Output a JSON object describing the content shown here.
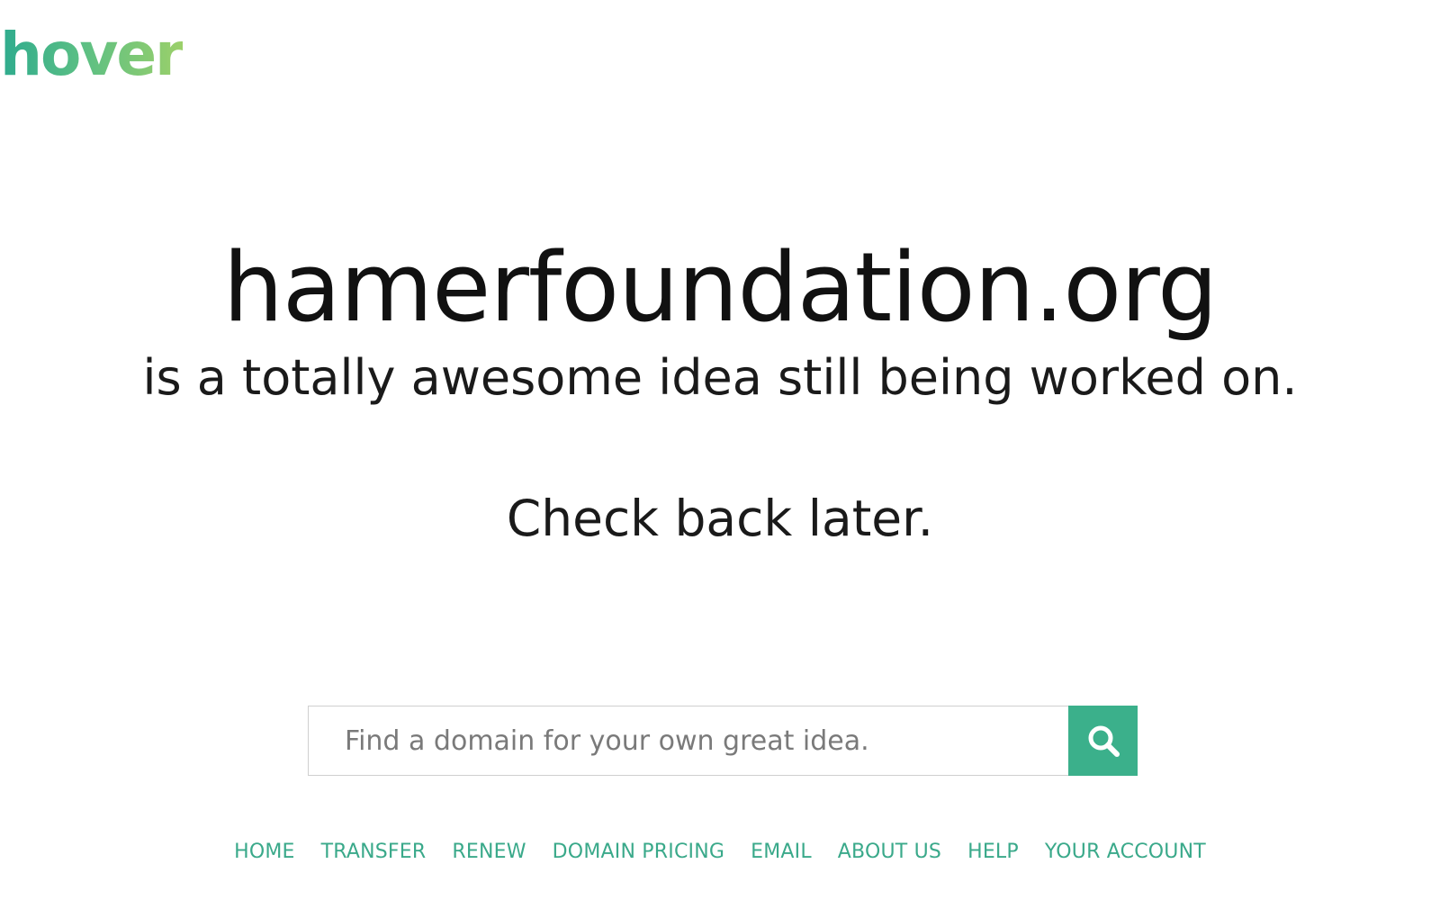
{
  "header": {
    "logo_text": "hover"
  },
  "main": {
    "domain": "hamerfoundation.org",
    "tagline": "is a totally awesome idea still being worked on.",
    "check_back": "Check back later."
  },
  "search": {
    "placeholder": "Find a domain for your own great idea.",
    "value": "",
    "button_icon": "search-icon"
  },
  "footer": {
    "links": [
      "HOME",
      "TRANSFER",
      "RENEW",
      "DOMAIN PRICING",
      "EMAIL",
      "ABOUT US",
      "HELP",
      "YOUR ACCOUNT"
    ]
  },
  "colors": {
    "brand_green": "#3bb08b",
    "logo_gradient_start": "#2eab8e",
    "logo_gradient_end": "#9bd06a",
    "link_color": "#3aa98a"
  }
}
